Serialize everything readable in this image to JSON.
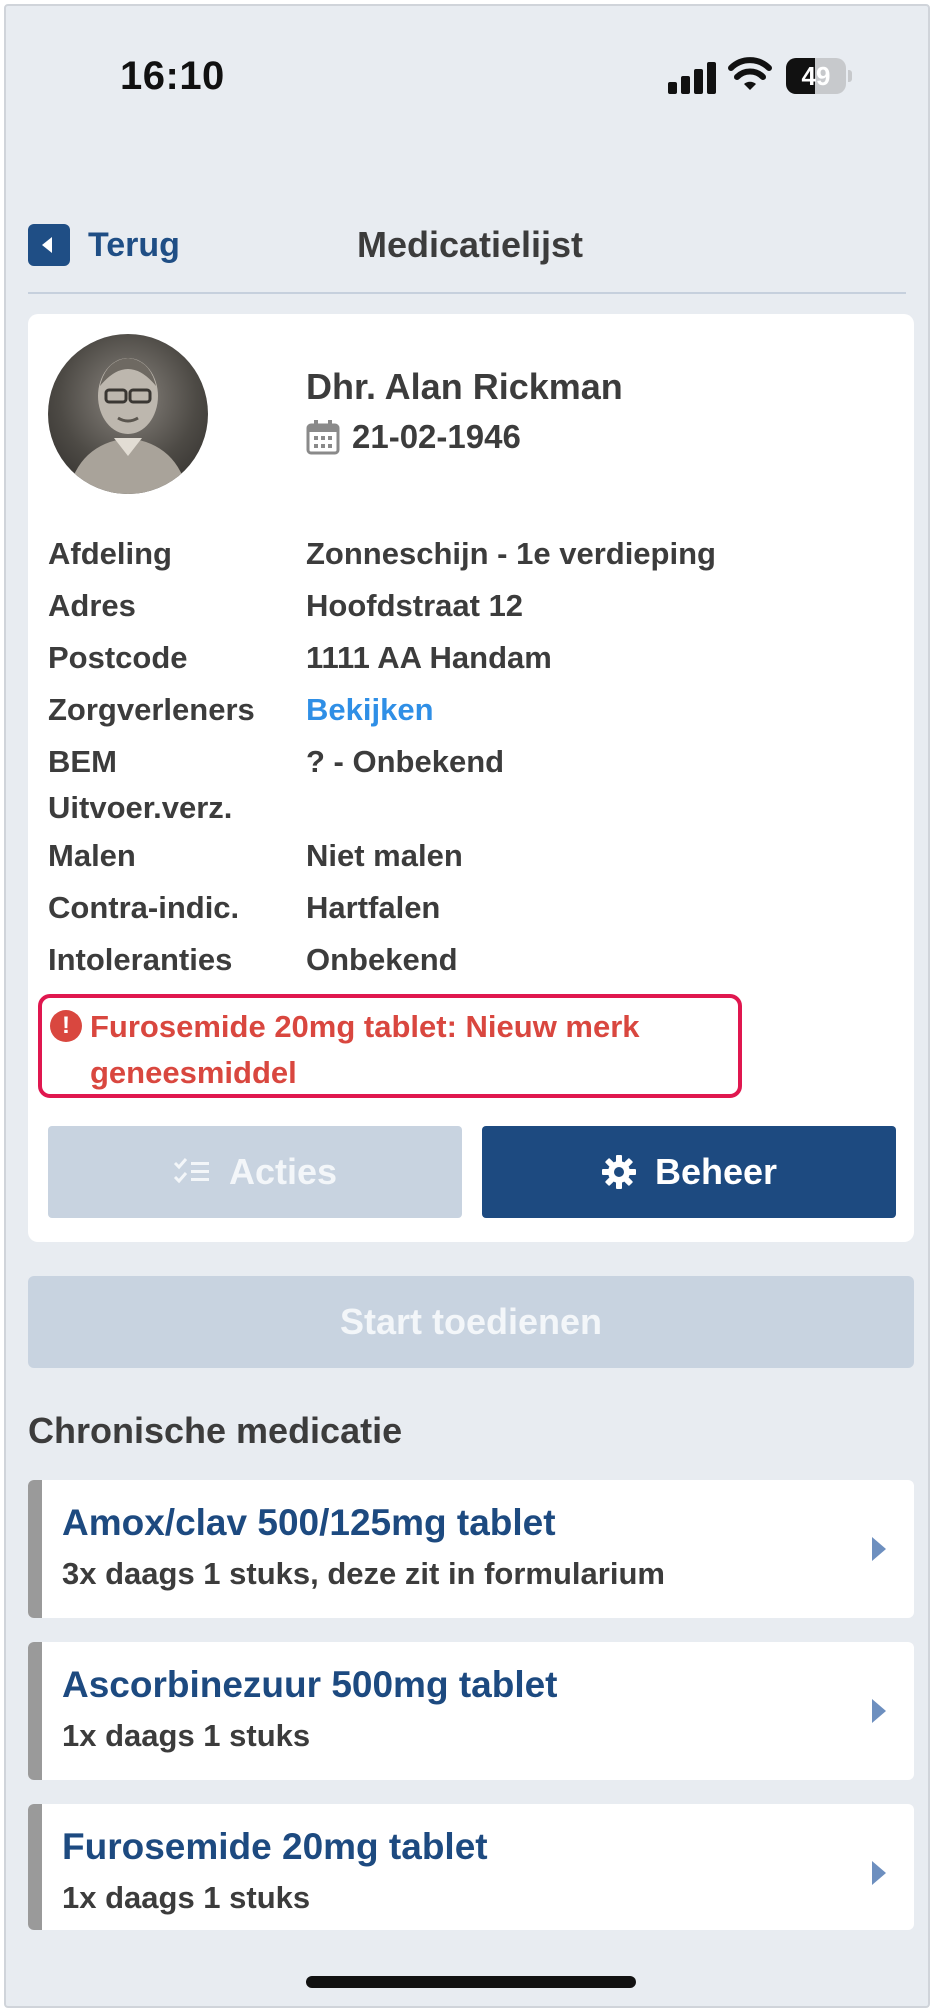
{
  "status_bar": {
    "time": "16:10",
    "battery_level": "49",
    "battery_fraction": 0.49
  },
  "header": {
    "back_label": "Terug",
    "title": "Medicatielijst"
  },
  "patient": {
    "name": "Dhr. Alan Rickman",
    "birth_date": "21-02-1946",
    "info": [
      {
        "label": "Afdeling",
        "value": "Zonneschijn - 1e verdieping",
        "link": false
      },
      {
        "label": "Adres",
        "value": "Hoofdstraat 12",
        "link": false
      },
      {
        "label": "Postcode",
        "value": "1111 AA Handam",
        "link": false
      },
      {
        "label": "Zorgverleners",
        "value": "Bekijken",
        "link": true
      },
      {
        "label": "BEM",
        "value": "? - Onbekend",
        "link": false
      },
      {
        "label": "Uitvoer.verz.",
        "value": "",
        "link": false
      },
      {
        "label": "Malen",
        "value": "Niet malen",
        "link": false
      },
      {
        "label": "Contra-indic.",
        "value": "Hartfalen",
        "link": false
      },
      {
        "label": "Intoleranties",
        "value": "Onbekend",
        "link": false
      }
    ],
    "alert": "Furosemide 20mg tablet: Nieuw merk geneesmiddel"
  },
  "actions": {
    "acties_label": "Acties",
    "beheer_label": "Beheer",
    "start_label": "Start toedienen"
  },
  "section_title": "Chronische medicatie",
  "medications": [
    {
      "name": "Amox/clav 500/125mg tablet",
      "dose": "3x daags 1 stuks, deze zit in formularium"
    },
    {
      "name": "Ascorbinezuur 500mg tablet",
      "dose": "1x daags 1 stuks"
    },
    {
      "name": "Furosemide 20mg tablet",
      "dose": "1x daags 1 stuks"
    }
  ],
  "icons": {
    "back": "chevron-left-icon",
    "calendar": "calendar-icon",
    "alert": "exclamation-circle-icon",
    "acties": "checklist-icon",
    "beheer": "gear-icon",
    "med_chevron": "chevron-right-icon"
  },
  "colors": {
    "primary": "#1d4a80",
    "link": "#2f8fe6",
    "alert": "#d9473f",
    "alert_border": "#e0174f",
    "disabled": "#c8d3e0",
    "background": "#e8ecf1"
  }
}
